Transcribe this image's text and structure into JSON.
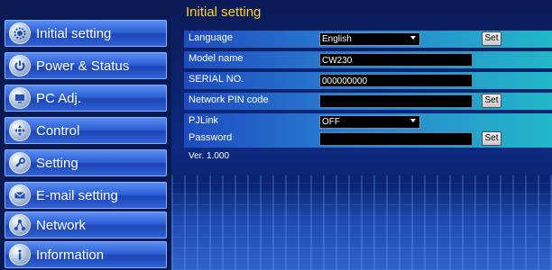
{
  "nav": {
    "items": [
      {
        "label": "Initial setting",
        "icon": "gear-icon"
      },
      {
        "label": "Power & Status",
        "icon": "power-icon"
      },
      {
        "label": "PC Adj.",
        "icon": "monitor-icon"
      },
      {
        "label": "Control",
        "icon": "dpad-icon"
      },
      {
        "label": "Setting",
        "icon": "wrench-icon"
      },
      {
        "label": "E-mail setting",
        "icon": "mail-icon"
      },
      {
        "label": "Network",
        "icon": "network-icon"
      },
      {
        "label": "Information",
        "icon": "info-icon"
      }
    ]
  },
  "main": {
    "title": "Initial setting",
    "language": {
      "label": "Language",
      "value": "English",
      "button": "Set"
    },
    "model_name": {
      "label": "Model name",
      "value": "CW230"
    },
    "serial_no": {
      "label": "SERIAL NO.",
      "value": "000000000"
    },
    "network_pin": {
      "label": "Network PIN code",
      "value": "",
      "button": "Set"
    },
    "pjlink": {
      "label": "PJLink",
      "value": "OFF"
    },
    "password": {
      "label": "Password",
      "value": "",
      "button": "Set"
    },
    "version": "Ver. 1.000"
  },
  "colors": {
    "title": "#ffd22a",
    "nav_button": "#2d5fd6",
    "row_gradient_start": "#1e4bbf",
    "row_gradient_end": "#22b8c8"
  }
}
